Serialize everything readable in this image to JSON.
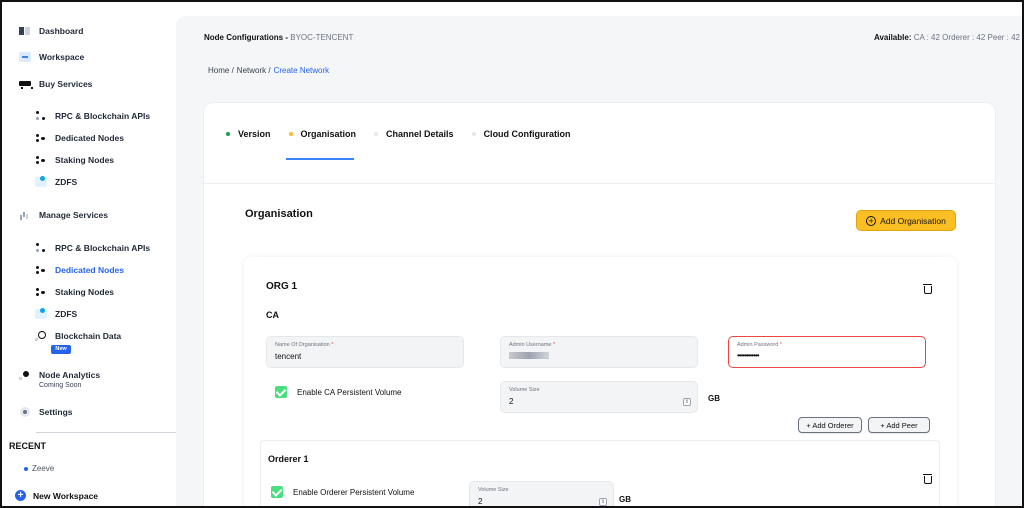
{
  "sidebar": {
    "dashboard": "Dashboard",
    "workspace": "Workspace",
    "buy_services": "Buy Services",
    "buy_items": [
      "RPC & Blockchain APIs",
      "Dedicated Nodes",
      "Staking Nodes",
      "ZDFS"
    ],
    "manage_services": "Manage Services",
    "manage_items": [
      "RPC & Blockchain APIs",
      "Dedicated Nodes",
      "Staking Nodes",
      "ZDFS",
      "Blockchain Data"
    ],
    "new_badge": "New",
    "node_analytics": "Node Analytics",
    "coming_soon": "Coming Soon",
    "settings": "Settings",
    "recent_label": "RECENT",
    "recent_item": "Zeeve",
    "new_workspace": "New Workspace"
  },
  "header": {
    "title": "Node Configurations -",
    "subtitle": "BYOC-TENCENT",
    "available_label": "Available:",
    "available_value": "CA : 42 Orderer : 42 Peer : 42"
  },
  "breadcrumb": [
    "Home /",
    "Network /",
    "Create Network"
  ],
  "tabs": [
    {
      "label": "Version",
      "color": "#16a34a"
    },
    {
      "label": "Organisation",
      "color": "#fbbf24"
    },
    {
      "label": "Channel Details",
      "color": "#e5e7eb"
    },
    {
      "label": "Cloud Configuration",
      "color": "#e5e7eb"
    }
  ],
  "section_title": "Organisation",
  "add_org_label": "Add Organisation",
  "org": {
    "title": "ORG 1",
    "ca_label": "CA",
    "name_label": "Name Of Organisation",
    "name_value": "tencent",
    "admin_user_label": "Admin Username",
    "admin_pass_label": "Admin Password",
    "admin_pass_value": "••••••••••••",
    "required_mark": "*",
    "ca_persist_label": "Enable CA Persistent Volume",
    "volume_label": "Volume Size",
    "ca_volume_value": "2",
    "unit": "GB",
    "add_orderer": "+ Add Orderer",
    "add_peer": "+ Add Peer"
  },
  "orderer": {
    "title": "Orderer 1",
    "persist_label": "Enable Orderer Persistent Volume",
    "volume_label": "Volume Size",
    "volume_value": "2",
    "unit": "GB"
  }
}
